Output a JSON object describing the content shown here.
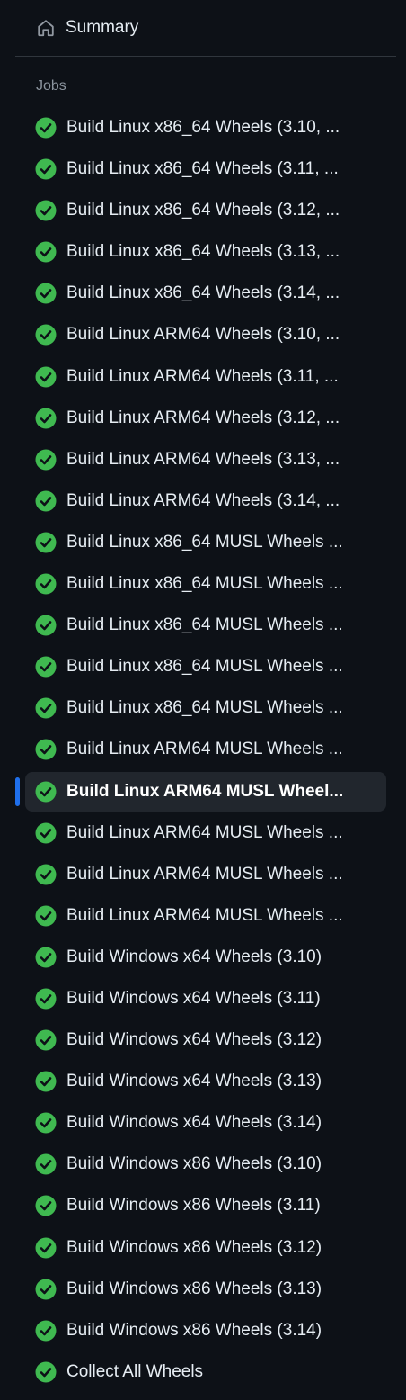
{
  "summary": {
    "label": "Summary",
    "icon": "home-icon"
  },
  "jobs_heading": "Jobs",
  "colors": {
    "background": "#0d1117",
    "success": "#3fb950",
    "selected_bg": "#21262d",
    "selected_indicator": "#1f6feb",
    "muted_text": "#8b949e"
  },
  "jobs": [
    {
      "label": "Build Linux x86_64 Wheels (3.10, ...",
      "status": "success"
    },
    {
      "label": "Build Linux x86_64 Wheels (3.11, ...",
      "status": "success"
    },
    {
      "label": "Build Linux x86_64 Wheels (3.12, ...",
      "status": "success"
    },
    {
      "label": "Build Linux x86_64 Wheels (3.13, ...",
      "status": "success"
    },
    {
      "label": "Build Linux x86_64 Wheels (3.14, ...",
      "status": "success"
    },
    {
      "label": "Build Linux ARM64 Wheels (3.10, ...",
      "status": "success"
    },
    {
      "label": "Build Linux ARM64 Wheels (3.11, ...",
      "status": "success"
    },
    {
      "label": "Build Linux ARM64 Wheels (3.12, ...",
      "status": "success"
    },
    {
      "label": "Build Linux ARM64 Wheels (3.13, ...",
      "status": "success"
    },
    {
      "label": "Build Linux ARM64 Wheels (3.14, ...",
      "status": "success"
    },
    {
      "label": "Build Linux x86_64 MUSL Wheels ...",
      "status": "success"
    },
    {
      "label": "Build Linux x86_64 MUSL Wheels ...",
      "status": "success"
    },
    {
      "label": "Build Linux x86_64 MUSL Wheels ...",
      "status": "success"
    },
    {
      "label": "Build Linux x86_64 MUSL Wheels ...",
      "status": "success"
    },
    {
      "label": "Build Linux x86_64 MUSL Wheels ...",
      "status": "success"
    },
    {
      "label": "Build Linux ARM64 MUSL Wheels ...",
      "status": "success"
    },
    {
      "label": "Build Linux ARM64 MUSL Wheel...",
      "status": "success",
      "selected": true
    },
    {
      "label": "Build Linux ARM64 MUSL Wheels ...",
      "status": "success"
    },
    {
      "label": "Build Linux ARM64 MUSL Wheels ...",
      "status": "success"
    },
    {
      "label": "Build Linux ARM64 MUSL Wheels ...",
      "status": "success"
    },
    {
      "label": "Build Windows x64 Wheels (3.10)",
      "status": "success"
    },
    {
      "label": "Build Windows x64 Wheels (3.11)",
      "status": "success"
    },
    {
      "label": "Build Windows x64 Wheels (3.12)",
      "status": "success"
    },
    {
      "label": "Build Windows x64 Wheels (3.13)",
      "status": "success"
    },
    {
      "label": "Build Windows x64 Wheels (3.14)",
      "status": "success"
    },
    {
      "label": "Build Windows x86 Wheels (3.10)",
      "status": "success"
    },
    {
      "label": "Build Windows x86 Wheels (3.11)",
      "status": "success"
    },
    {
      "label": "Build Windows x86 Wheels (3.12)",
      "status": "success"
    },
    {
      "label": "Build Windows x86 Wheels (3.13)",
      "status": "success"
    },
    {
      "label": "Build Windows x86 Wheels (3.14)",
      "status": "success"
    },
    {
      "label": "Collect All Wheels",
      "status": "success"
    }
  ]
}
